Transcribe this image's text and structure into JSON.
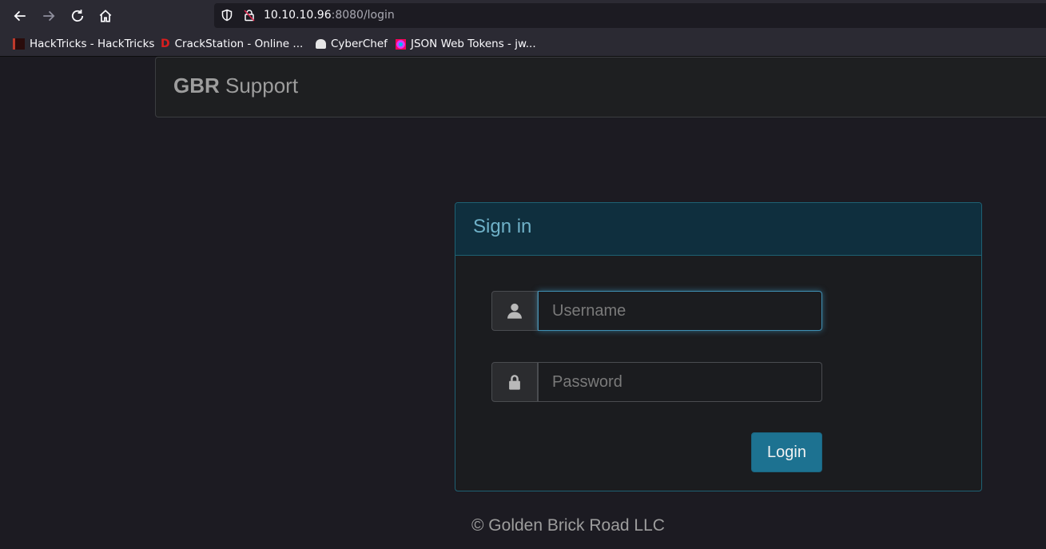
{
  "browser": {
    "url_host": "10.10.10.96",
    "url_rest": ":8080/login",
    "bookmarks": [
      {
        "label": "HackTricks - HackTricks",
        "icon": "hacktricks-icon",
        "color": "#c0392b"
      },
      {
        "label": "CrackStation - Online ...",
        "icon": "crackstation-icon",
        "color": "#d81e1e"
      },
      {
        "label": "CyberChef",
        "icon": "chef-hat-icon",
        "color": "#e6e6e6"
      },
      {
        "label": "JSON Web Tokens - jw...",
        "icon": "jwt-icon",
        "color": "#d63aff"
      }
    ]
  },
  "navbar": {
    "brand_bold": "GBR",
    "brand_rest": " Support"
  },
  "login": {
    "title": "Sign in",
    "username_placeholder": "Username",
    "password_placeholder": "Password",
    "submit_label": "Login"
  },
  "footer": {
    "text": "© Golden Brick Road LLC"
  },
  "colors": {
    "accent": "#1d7291",
    "panel_heading": "#0f2f3e",
    "panel_border": "#1e6173",
    "background": "#1c1b22"
  }
}
